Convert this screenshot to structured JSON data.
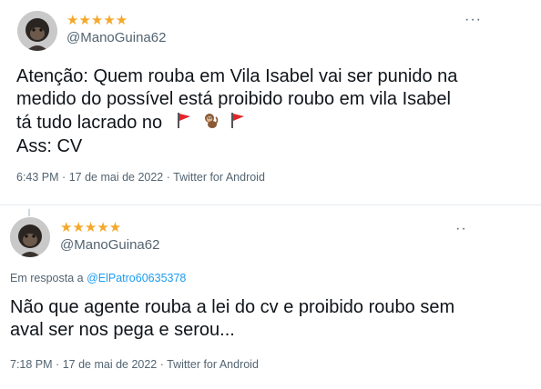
{
  "tweets": [
    {
      "stars": "★★★★★",
      "handle": "@ManoGuina62",
      "more": "···",
      "lines": [
        "Atenção: Quem rouba em Vila Isabel vai ser punido na",
        "medido do possível está proibido roubo em vila Isabel",
        "tá tudo lacrado no",
        "Ass: CV"
      ],
      "emojis": [
        "red-flag-icon",
        "monkey-icon",
        "red-flag-icon"
      ],
      "time": "6:43 PM",
      "date": "17 de mai de 2022",
      "source": "Twitter for Android",
      "sep": "·"
    },
    {
      "stars": "★★★★★",
      "handle": "@ManoGuina62",
      "more": "··",
      "reply_prefix": "Em resposta a",
      "reply_to": "@ElPatro60635378",
      "lines": [
        "Não que agente rouba a lei do cv e proibido roubo sem",
        "aval ser nos pega e serou..."
      ],
      "time": "7:18 PM",
      "date": "17 de mai de 2022",
      "source": "Twitter for Android",
      "sep": "·"
    }
  ],
  "colors": {
    "accent": "#1d9bf0",
    "secondary": "#536471",
    "star": "#f4a82b",
    "flag": "#e0262b"
  }
}
